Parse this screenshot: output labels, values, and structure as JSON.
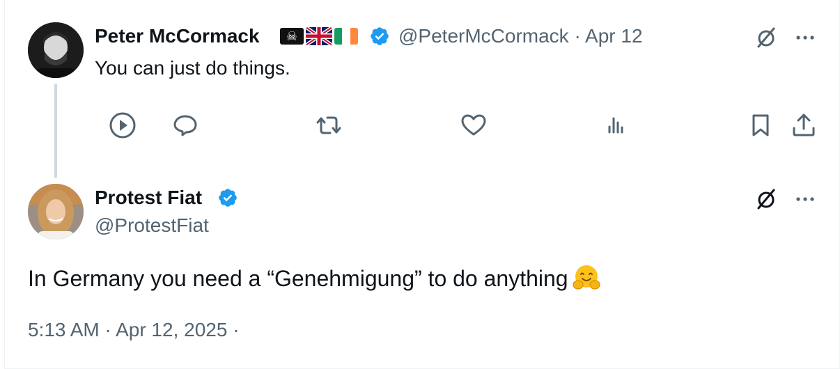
{
  "original_tweet": {
    "author_name": "Peter McCormack",
    "handle_and_date": "@PeterMcCormack · Apr 12",
    "text": "You can just do things.",
    "flag_emojis": [
      "pirate-flag",
      "uk-flag",
      "ireland-flag"
    ],
    "actions": [
      "play-icon",
      "reply-icon",
      "retweet-icon",
      "like-icon",
      "views-icon",
      "bookmark-icon",
      "share-icon"
    ]
  },
  "reply_tweet": {
    "author_name": "Protest Fiat",
    "handle": "@ProtestFiat",
    "text": "In Germany you need a “Genehmigung” to do anything",
    "emoji": "hugging-face-emoji",
    "timestamp": "5:13 AM · Apr 12, 2025 ·"
  },
  "colors": {
    "text": "#0f1419",
    "secondary": "#536471",
    "verified": "#1d9bf0",
    "thread_line": "#cfd9de"
  }
}
